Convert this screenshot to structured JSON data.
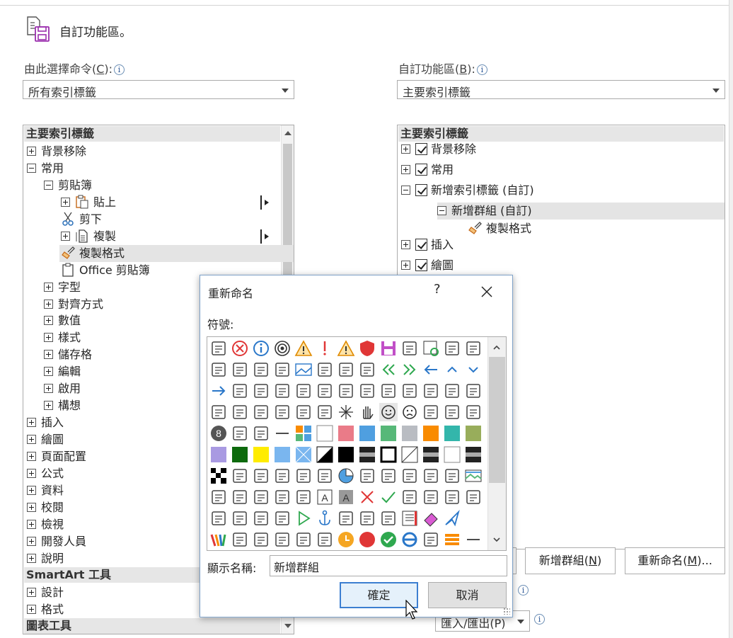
{
  "header": {
    "title": "自訂功能區。"
  },
  "left": {
    "label": "由此選擇命令(C):",
    "label_main": "由此選擇命令(",
    "label_key": "C",
    "label_end": "):",
    "combo_value": "所有索引標籤",
    "tree": [
      {
        "text": "主要索引標籤",
        "type": "header"
      },
      {
        "text": "背景移除",
        "level": 0,
        "pm": "plus"
      },
      {
        "text": "常用",
        "level": 0,
        "pm": "minus"
      },
      {
        "text": "剪貼簿",
        "level": 1,
        "pm": "minus"
      },
      {
        "text": "貼上",
        "level": 2,
        "pm": "plus",
        "icon": "paste-icon",
        "sub": true
      },
      {
        "text": "剪下",
        "level": 2,
        "icon": "scissors-icon"
      },
      {
        "text": "複製",
        "level": 2,
        "pm": "plus",
        "icon": "copy-icon",
        "sub": true
      },
      {
        "text": "複製格式",
        "level": 2,
        "icon": "format-painter-icon",
        "selected": true
      },
      {
        "text": "Office 剪貼簿",
        "level": 2,
        "icon": "clipboard-icon"
      },
      {
        "text": "字型",
        "level": 1,
        "pm": "plus"
      },
      {
        "text": "對齊方式",
        "level": 1,
        "pm": "plus"
      },
      {
        "text": "數值",
        "level": 1,
        "pm": "plus"
      },
      {
        "text": "樣式",
        "level": 1,
        "pm": "plus"
      },
      {
        "text": "儲存格",
        "level": 1,
        "pm": "plus"
      },
      {
        "text": "編輯",
        "level": 1,
        "pm": "plus"
      },
      {
        "text": "啟用",
        "level": 1,
        "pm": "plus"
      },
      {
        "text": "構想",
        "level": 1,
        "pm": "plus"
      },
      {
        "text": "插入",
        "level": 0,
        "pm": "plus"
      },
      {
        "text": "繪圖",
        "level": 0,
        "pm": "plus"
      },
      {
        "text": "頁面配置",
        "level": 0,
        "pm": "plus"
      },
      {
        "text": "公式",
        "level": 0,
        "pm": "plus"
      },
      {
        "text": "資料",
        "level": 0,
        "pm": "plus"
      },
      {
        "text": "校閱",
        "level": 0,
        "pm": "plus"
      },
      {
        "text": "檢視",
        "level": 0,
        "pm": "plus"
      },
      {
        "text": "開發人員",
        "level": 0,
        "pm": "plus"
      },
      {
        "text": "說明",
        "level": 0,
        "pm": "plus"
      },
      {
        "text": "SmartArt 工具",
        "type": "header"
      },
      {
        "text": "設計",
        "level": 0,
        "pm": "plus"
      },
      {
        "text": "格式",
        "level": 0,
        "pm": "plus"
      },
      {
        "text": "圖表工具",
        "type": "header"
      }
    ]
  },
  "right": {
    "label_main": "自訂功能區(",
    "label_key": "B",
    "label_end": "):",
    "combo_value": "主要索引標籤",
    "tree": [
      {
        "text": "主要索引標籤",
        "type": "header"
      },
      {
        "text": "背景移除",
        "check": true,
        "pm": "plus"
      },
      {
        "text": "常用",
        "check": true,
        "pm": "plus"
      },
      {
        "text": "新增索引標籤 (自訂)",
        "check": true,
        "pm": "minus"
      },
      {
        "text": "新增群組 (自訂)",
        "pm": "minus",
        "level": 1,
        "selected": true
      },
      {
        "text": "複製格式",
        "level": 2,
        "icon": "format-painter-icon"
      },
      {
        "text": "插入",
        "check": true,
        "pm": "plus"
      },
      {
        "text": "繪圖",
        "check": true,
        "pm": "plus"
      }
    ],
    "buttons": {
      "new_group": "新增群組(N)",
      "new_group_main": "新增群組(",
      "new_group_key": "N",
      "new_group_end": ")",
      "rename_main": "重新命名(",
      "rename_key": "M",
      "rename_end": ")...",
      "import_export": "匯入/匯出(P)"
    }
  },
  "dialog": {
    "title": "重新命名",
    "help": "?",
    "symbols_label": "符號:",
    "display_name_label": "顯示名稱:",
    "display_name_value": "新增群組",
    "ok": "確定",
    "cancel": "取消"
  },
  "colors": {
    "accent": "#3c7fd1",
    "selection": "#e4e4e4",
    "header_bg": "#e6e6e6"
  }
}
